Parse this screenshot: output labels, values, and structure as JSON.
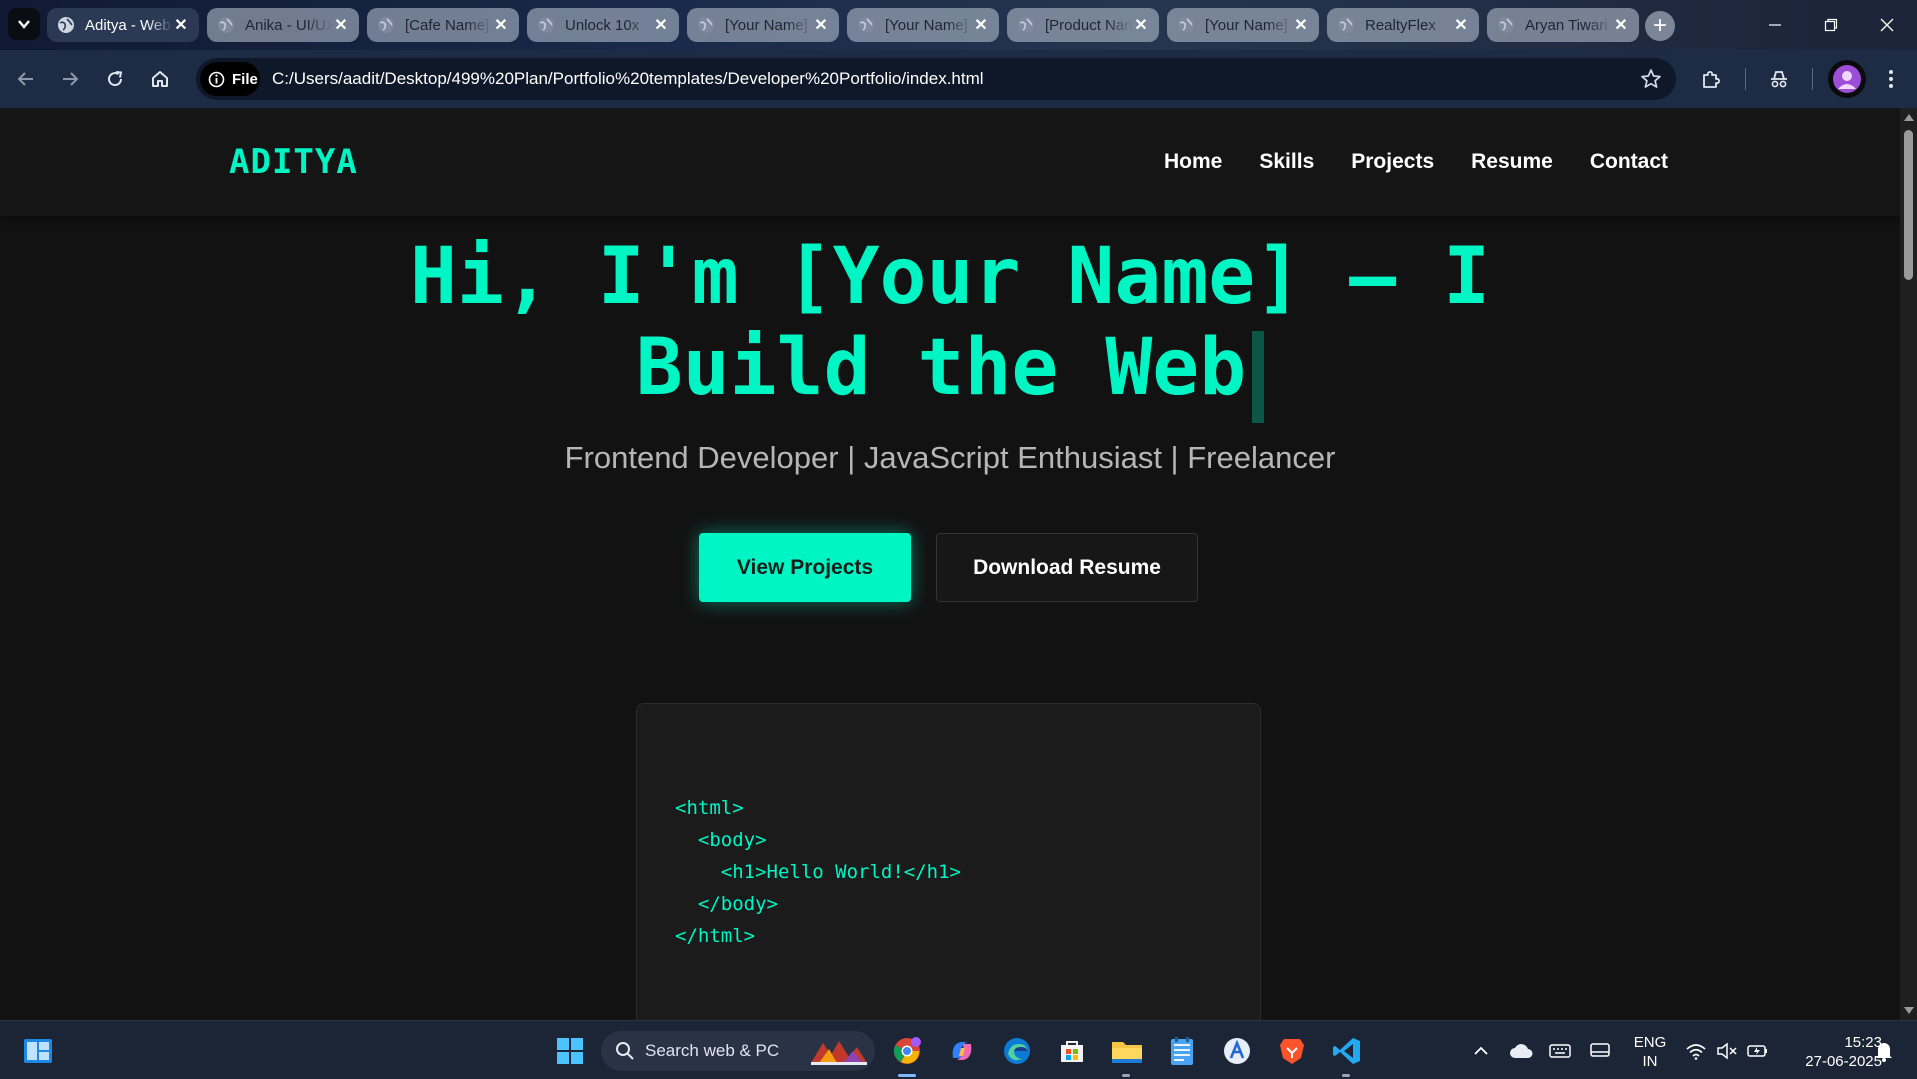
{
  "browser": {
    "tabs": [
      {
        "title": "Aditya - Web Developer",
        "active": true
      },
      {
        "title": "Anika - UI/UX",
        "active": false
      },
      {
        "title": "[Cafe Name]",
        "active": false
      },
      {
        "title": "Unlock 10x",
        "active": false
      },
      {
        "title": "[Your Name]",
        "active": false
      },
      {
        "title": "[Your Name]",
        "active": false
      },
      {
        "title": "[Product Name]",
        "active": false
      },
      {
        "title": "[Your Name]",
        "active": false
      },
      {
        "title": "RealtyFlex",
        "active": false
      },
      {
        "title": "Aryan Tiwari",
        "active": false
      }
    ],
    "address_chip": "File",
    "url": "C:/Users/aadit/Desktop/499%20Plan/Portfolio%20templates/Developer%20Portfolio/index.html"
  },
  "page": {
    "brand": "ADITYA",
    "nav": [
      "Home",
      "Skills",
      "Projects",
      "Resume",
      "Contact"
    ],
    "hero_line1": "Hi, I'm [Your Name] — I",
    "hero_line2": "Build the Web",
    "subtitle": "Frontend Developer | JavaScript Enthusiast | Freelancer",
    "primary_button": "View Projects",
    "secondary_button": "Download Resume",
    "code_lines": [
      "<html>",
      "  <body>",
      "    <h1>Hello World!</h1>",
      "  </body>",
      "</html>"
    ],
    "accent_color": "#00f5c4"
  },
  "taskbar": {
    "search_placeholder": "Search web & PC",
    "language": "ENG",
    "region": "IN",
    "time": "15:23",
    "date": "27-06-2025"
  }
}
